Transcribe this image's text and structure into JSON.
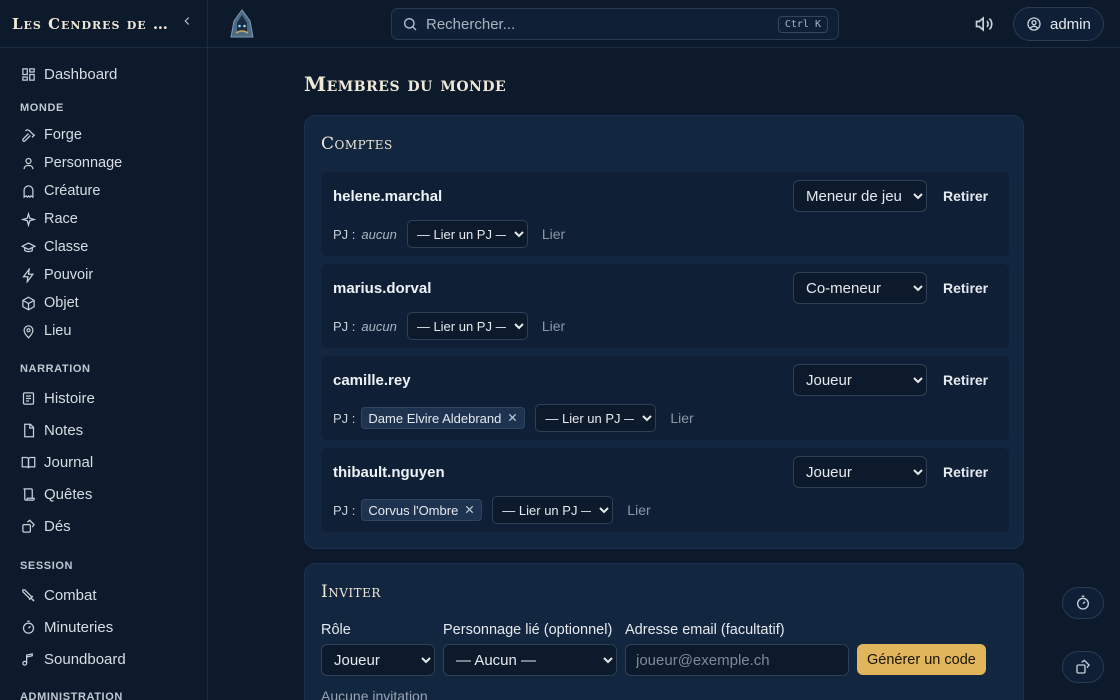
{
  "app": {
    "title": "Les Cendres de S..."
  },
  "sidebar": {
    "dashboard": "Dashboard",
    "sections": [
      {
        "label": "Monde",
        "items": [
          "Forge",
          "Personnage",
          "Créature",
          "Race",
          "Classe",
          "Pouvoir",
          "Objet",
          "Lieu"
        ]
      },
      {
        "label": "Narration",
        "items": [
          "Histoire",
          "Notes",
          "Journal",
          "Quêtes",
          "Dés"
        ]
      },
      {
        "label": "Session",
        "items": [
          "Combat",
          "Minuteries",
          "Soundboard"
        ]
      },
      {
        "label": "Administration",
        "items": []
      }
    ]
  },
  "topbar": {
    "search_placeholder": "Rechercher...",
    "shortcut": "Ctrl K",
    "user": "admin"
  },
  "page": {
    "title": "Membres du monde"
  },
  "accounts": {
    "title": "Comptes",
    "pj_label": "PJ :",
    "none_label": "aucun",
    "link_placeholder": "— Lier un PJ —",
    "link_button": "Lier",
    "remove_button": "Retirer",
    "rows": [
      {
        "username": "helene.marchal",
        "role": "Meneur de jeu",
        "pj": ""
      },
      {
        "username": "marius.dorval",
        "role": "Co-meneur",
        "pj": ""
      },
      {
        "username": "camille.rey",
        "role": "Joueur",
        "pj": "Dame Elvire Aldebrand"
      },
      {
        "username": "thibault.nguyen",
        "role": "Joueur",
        "pj": "Corvus l'Ombre"
      }
    ]
  },
  "invite": {
    "title": "Inviter",
    "role_label": "Rôle",
    "role_value": "Joueur",
    "character_label": "Personnage lié (optionnel)",
    "character_value": "— Aucun —",
    "email_label": "Adresse email (facultatif)",
    "email_placeholder": "joueur@exemple.ch",
    "generate_button": "Générer un code",
    "no_invites": "Aucune invitation"
  }
}
